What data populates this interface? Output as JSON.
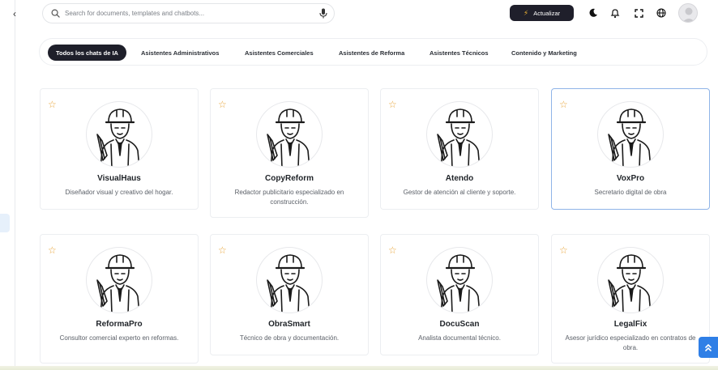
{
  "search": {
    "placeholder": "Search for documents, templates and chatbots..."
  },
  "header": {
    "upgrade_label": "Actualizar"
  },
  "tabs": [
    {
      "label": "Todos los chats de IA"
    },
    {
      "label": "Asistentes Administrativos"
    },
    {
      "label": "Asistentes Comerciales"
    },
    {
      "label": "Asistentes de Reforma"
    },
    {
      "label": "Asistentes Técnicos"
    },
    {
      "label": "Contenido y Marketing"
    }
  ],
  "cards": [
    {
      "name": "VisualHaus",
      "desc": "Diseñador visual y creativo del hogar."
    },
    {
      "name": "CopyReform",
      "desc": "Redactor publicitario especializado en construcción."
    },
    {
      "name": "Atendo",
      "desc": "Gestor de atención al cliente y soporte."
    },
    {
      "name": "VoxPro",
      "desc": "Secretario digital de obra"
    },
    {
      "name": "ReformaPro",
      "desc": "Consultor comercial experto en reformas."
    },
    {
      "name": "ObraSmart",
      "desc": "Técnico de obra y documentación."
    },
    {
      "name": "DocuScan",
      "desc": "Analista documental técnico."
    },
    {
      "name": "LegalFix",
      "desc": "Asesor jurídico especializado en contratos de obra."
    }
  ],
  "colors": {
    "accent": "#2f7fe6",
    "dark": "#1e1f2a",
    "star": "#e8a53a"
  }
}
